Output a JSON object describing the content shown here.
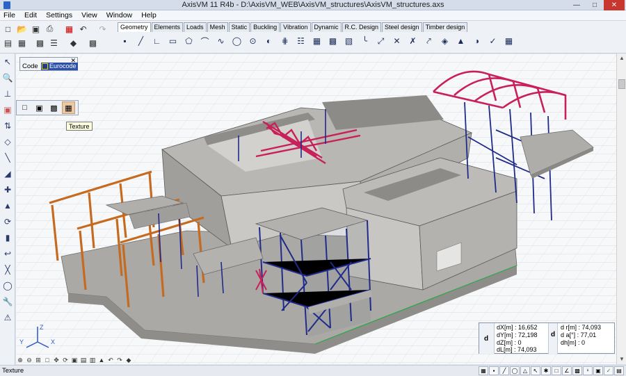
{
  "window": {
    "title": "AxisVM 11 R4b - D:\\AxisVM_WEB\\AxisVM_structures\\AxisVM_structures.axs"
  },
  "menu": [
    "File",
    "Edit",
    "Settings",
    "View",
    "Window",
    "Help"
  ],
  "tabs": [
    "Geometry",
    "Elements",
    "Loads",
    "Mesh",
    "Static",
    "Buckling",
    "Vibration",
    "Dynamic",
    "R.C. Design",
    "Steel design",
    "Timber design"
  ],
  "active_tab": "Geometry",
  "code_panel": {
    "label": "Code",
    "value": "Eurocode"
  },
  "tooltip": "Texture",
  "axes": {
    "z": "Z",
    "y": "Y",
    "x": "X"
  },
  "coordinates": {
    "left_label": "d",
    "mid_label": "d",
    "dX": "dX[m] : 16,652",
    "dY": "dY[m] : 72,198",
    "dZ": "dZ[m] : 0",
    "dL": "dL[m] : 74,093",
    "dr": "d r[m] : 74,093",
    "da": "d  a[°] : 77,01",
    "dh": "dh[m] : 0"
  },
  "status": {
    "message": "Texture"
  },
  "colors": {
    "steel_blue": "#1f2a8a",
    "truss_red": "#c7205a",
    "timber_orange": "#c56a1f",
    "concrete": "#a9a7a2"
  }
}
